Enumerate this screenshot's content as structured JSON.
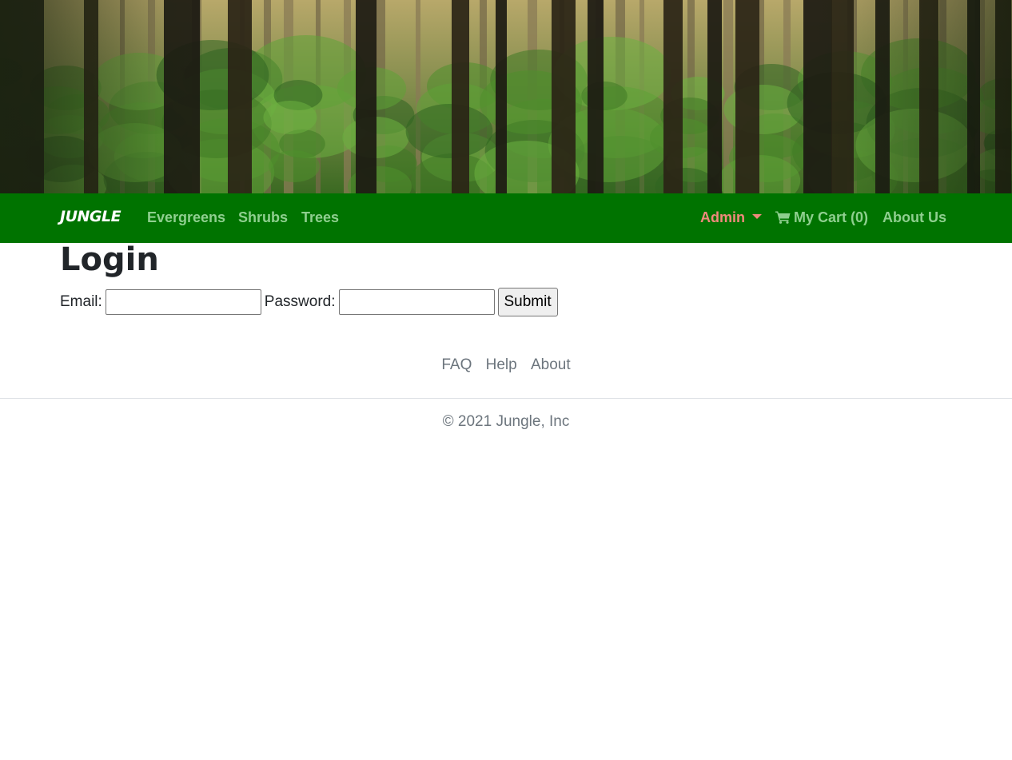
{
  "navbar": {
    "brand": "JUNGLE",
    "links": {
      "evergreens": "Evergreens",
      "shrubs": "Shrubs",
      "trees": "Trees"
    },
    "admin": "Admin",
    "cart": "My Cart (0)",
    "about_us": "About Us",
    "colors": {
      "background": "#007300",
      "link": "#8fcf8f",
      "admin": "#f08a7c"
    }
  },
  "hero": {
    "icon": "forest-banner-image"
  },
  "login": {
    "title": "Login",
    "email_label": "Email:",
    "email_value": "",
    "password_label": "Password:",
    "password_value": "",
    "submit_label": "Submit"
  },
  "footer": {
    "links": {
      "faq": "FAQ",
      "help": "Help",
      "about": "About"
    },
    "copyright": "© 2021 Jungle, Inc"
  }
}
